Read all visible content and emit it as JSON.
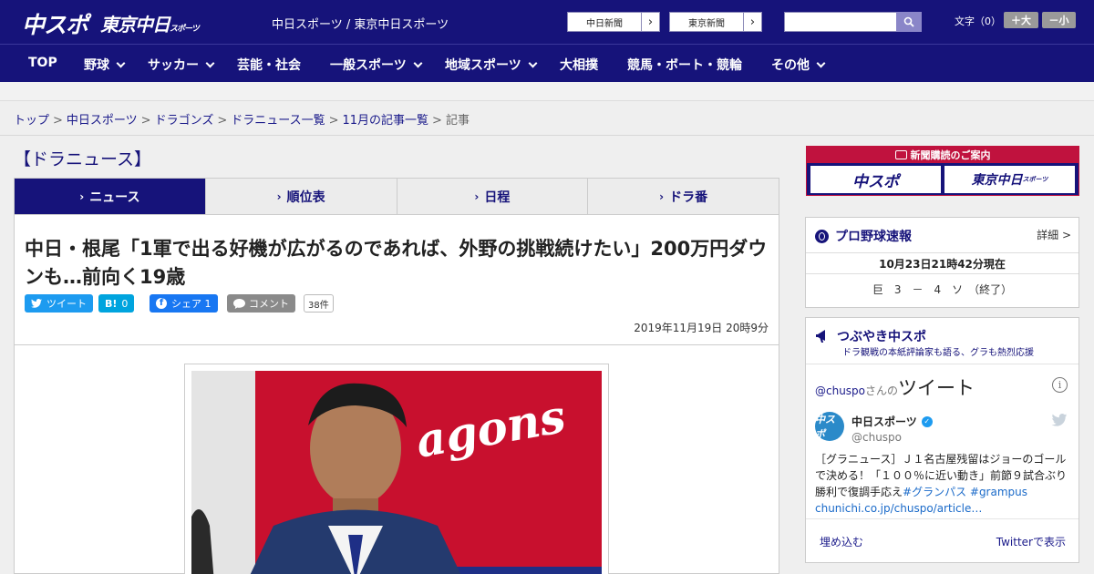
{
  "header": {
    "logo_chuspo": "中スポ",
    "logo_tokyo": "東京中日",
    "logo_tokyo_small": "スポーツ",
    "site_title": "中日スポーツ / 東京中日スポーツ",
    "paper_links": [
      "中日新聞",
      "東京新聞"
    ],
    "search": {
      "value": "",
      "placeholder": ""
    },
    "font_size_label": "文字（0）",
    "font_plus": "＋大",
    "font_minus": "－小"
  },
  "nav": {
    "items": [
      {
        "label": "TOP",
        "dropdown": false
      },
      {
        "label": "野球",
        "dropdown": true
      },
      {
        "label": "サッカー",
        "dropdown": true
      },
      {
        "label": "芸能・社会",
        "dropdown": false
      },
      {
        "label": "一般スポーツ",
        "dropdown": true
      },
      {
        "label": "地域スポーツ",
        "dropdown": true
      },
      {
        "label": "大相撲",
        "dropdown": false
      },
      {
        "label": "競馬・ボート・競輪",
        "dropdown": false
      },
      {
        "label": "その他",
        "dropdown": true
      }
    ]
  },
  "breadcrumb": {
    "items": [
      "トップ",
      "中日スポーツ",
      "ドラゴンズ",
      "ドラニュース一覧",
      "11月の記事一覧"
    ],
    "current": "記事",
    "separator": ">"
  },
  "section_title": "【ドラニュース】",
  "tabs": [
    {
      "label": "ニュース",
      "active": true
    },
    {
      "label": "順位表",
      "active": false
    },
    {
      "label": "日程",
      "active": false
    },
    {
      "label": "ドラ番",
      "active": false
    }
  ],
  "article": {
    "headline": "中日・根尾「1軍で出る好機が広がるのであれば、外野の挑戦続けたい」200万円ダウンも…前向く19歳",
    "share": {
      "tweet": "ツイート",
      "hatena_icon": "B!",
      "hatena_count": "0",
      "facebook": "シェア 1",
      "comment": "コメント",
      "comment_count": "38件"
    },
    "date": "2019年11月19日 20時9分",
    "photo_text": "agons"
  },
  "sidebar": {
    "subscription": {
      "title": "新聞購読のご案内",
      "buttons": [
        "中スポ",
        "東京中日"
      ],
      "buttons_small": "スポーツ"
    },
    "baseball": {
      "title": "プロ野球速報",
      "detail": "詳細 >",
      "updated": "10月23日21時42分現在",
      "score": "巨　3　－　4　ソ　（終了）"
    },
    "twitter": {
      "title": "つぶやき中スポ",
      "subtitle": "ドラ観戦の本紙評論家も語る、グラも熱烈応援",
      "handle_prefix": "@chuspo",
      "handle_mid": "さんの",
      "handle_big": "ツイート",
      "user_name": "中日スポーツ",
      "screen_name": "@chuspo",
      "avatar_text": "中スポ",
      "tweet_text": "［グラニュース］Ｊ１名古屋残留はジョーのゴールで決める！「１００％に近い動き」前節９試合ぶり勝利で復調手応え",
      "tweet_tags": "#グランパス #grampus",
      "tweet_link": "chunichi.co.jp/chuspo/article…",
      "embed": "埋め込む",
      "view_on": "Twitterで表示"
    }
  },
  "colors": {
    "brand_navy": "#16137a",
    "accent_red": "#c0123e",
    "twitter_blue": "#1d9bf0",
    "hatena_blue": "#00a4de",
    "facebook_blue": "#1877f2",
    "comment_gray": "#8a8a8a"
  }
}
